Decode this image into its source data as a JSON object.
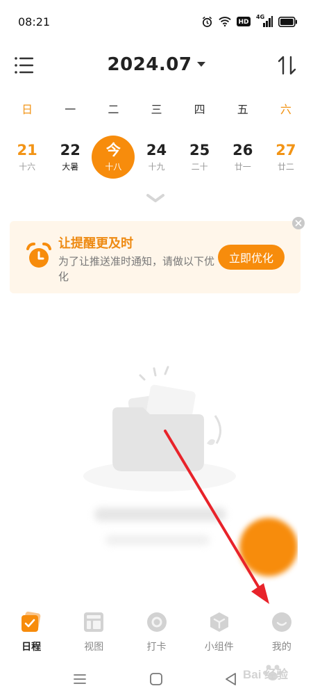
{
  "status_bar": {
    "time": "08:21",
    "icons": [
      "alarm-icon",
      "wifi-icon",
      "hd-icon",
      "cellular-signal-icon",
      "battery-icon"
    ],
    "hd_text": "HD",
    "net_text": "4G"
  },
  "header": {
    "month": "2024.07"
  },
  "weekdays": [
    "日",
    "一",
    "二",
    "三",
    "四",
    "五",
    "六"
  ],
  "days": [
    {
      "num": "21",
      "lunar": "十六"
    },
    {
      "num": "22",
      "lunar": "大暑"
    },
    {
      "num": "今",
      "lunar": "十八"
    },
    {
      "num": "24",
      "lunar": "十九"
    },
    {
      "num": "25",
      "lunar": "二十"
    },
    {
      "num": "26",
      "lunar": "廿一"
    },
    {
      "num": "27",
      "lunar": "廿二"
    }
  ],
  "reminder": {
    "title": "让提醒更及时",
    "description": "为了让推送准时通知，请做以下优化",
    "button": "立即优化"
  },
  "bottom_nav": [
    {
      "label": "日程",
      "active": true
    },
    {
      "label": "视图",
      "active": false
    },
    {
      "label": "打卡",
      "active": false
    },
    {
      "label": "小组件",
      "active": false
    },
    {
      "label": "我的",
      "active": false
    }
  ],
  "colors": {
    "accent": "#f78c0c",
    "weekend": "#f29416",
    "card_bg": "#fff6ea",
    "annotation": "#e8232a"
  },
  "watermark": {
    "text": "Bai 经验"
  }
}
